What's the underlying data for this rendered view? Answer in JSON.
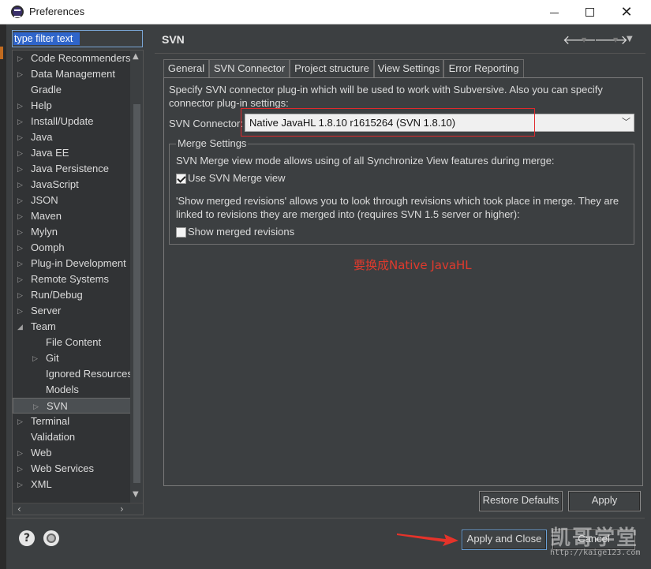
{
  "window": {
    "title": "Preferences",
    "close_glyph": "✕"
  },
  "filter": {
    "placeholder": "type filter text"
  },
  "tree": {
    "items": [
      {
        "label": "Code Recommenders",
        "expander": "▷",
        "level": 0
      },
      {
        "label": "Data Management",
        "expander": "▷",
        "level": 0
      },
      {
        "label": "Gradle",
        "expander": "",
        "level": 0
      },
      {
        "label": "Help",
        "expander": "▷",
        "level": 0
      },
      {
        "label": "Install/Update",
        "expander": "▷",
        "level": 0
      },
      {
        "label": "Java",
        "expander": "▷",
        "level": 0
      },
      {
        "label": "Java EE",
        "expander": "▷",
        "level": 0
      },
      {
        "label": "Java Persistence",
        "expander": "▷",
        "level": 0
      },
      {
        "label": "JavaScript",
        "expander": "▷",
        "level": 0
      },
      {
        "label": "JSON",
        "expander": "▷",
        "level": 0
      },
      {
        "label": "Maven",
        "expander": "▷",
        "level": 0
      },
      {
        "label": "Mylyn",
        "expander": "▷",
        "level": 0
      },
      {
        "label": "Oomph",
        "expander": "▷",
        "level": 0
      },
      {
        "label": "Plug-in Development",
        "expander": "▷",
        "level": 0
      },
      {
        "label": "Remote Systems",
        "expander": "▷",
        "level": 0
      },
      {
        "label": "Run/Debug",
        "expander": "▷",
        "level": 0
      },
      {
        "label": "Server",
        "expander": "▷",
        "level": 0
      },
      {
        "label": "Team",
        "expander": "◢",
        "level": 0
      },
      {
        "label": "File Content",
        "expander": "",
        "level": 1
      },
      {
        "label": "Git",
        "expander": "▷",
        "level": 1
      },
      {
        "label": "Ignored Resources",
        "expander": "",
        "level": 1
      },
      {
        "label": "Models",
        "expander": "",
        "level": 1
      },
      {
        "label": "SVN",
        "expander": "▷",
        "level": 1,
        "selected": true
      },
      {
        "label": "Terminal",
        "expander": "▷",
        "level": 0
      },
      {
        "label": "Validation",
        "expander": "",
        "level": 0
      },
      {
        "label": "Web",
        "expander": "▷",
        "level": 0
      },
      {
        "label": "Web Services",
        "expander": "▷",
        "level": 0
      },
      {
        "label": "XML",
        "expander": "▷",
        "level": 0
      }
    ],
    "scroll": {
      "up": "▲",
      "down": "▼",
      "left": "‹",
      "right": "›"
    }
  },
  "page": {
    "title": "SVN",
    "nav": {
      "back": "🡐",
      "forward": "🡒",
      "dropdown": "▼",
      "menu": "▼"
    }
  },
  "tabs": [
    {
      "label": "General",
      "active": false
    },
    {
      "label": "SVN Connector",
      "active": true
    },
    {
      "label": "Project structure",
      "active": false
    },
    {
      "label": "View Settings",
      "active": false
    },
    {
      "label": "Error Reporting",
      "active": false
    }
  ],
  "connector": {
    "description": "Specify SVN connector plug-in which will be used to work with Subversive. Also you can specify connector plug-in settings:",
    "label": "SVN Connector:",
    "selected": "Native JavaHL 1.8.10 r1615264 (SVN 1.8.10)",
    "chevron": "﹀"
  },
  "merge": {
    "legend": "Merge Settings",
    "description": "SVN Merge view mode allows using of all Synchronize View features during merge:",
    "use_merge_view": {
      "label": "Use SVN Merge view",
      "checked": true
    },
    "show_description": "'Show merged revisions' allows you to look through revisions which took place in merge. They are linked to revisions they are merged into (requires SVN 1.5 server or higher):",
    "show_merged": {
      "label": "Show merged revisions",
      "checked": false
    }
  },
  "annotation": {
    "text": "要换成Native JavaHL",
    "color": "#e03a2d"
  },
  "buttons": {
    "restore_defaults": "Restore Defaults",
    "apply": "Apply",
    "apply_and_close": "Apply and Close",
    "cancel": "Cancel"
  },
  "footer_icons": {
    "help": "?"
  },
  "watermark": {
    "text": "凯哥学堂",
    "url": "http://kaige123.com"
  }
}
